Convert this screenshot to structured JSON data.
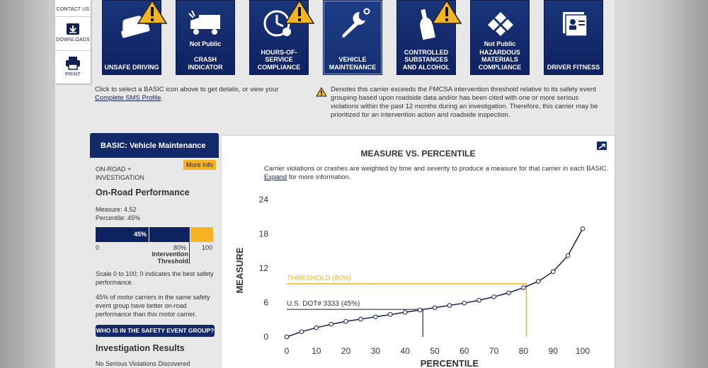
{
  "toolbar": {
    "contact": "CONTACT US",
    "downloads": "DOWNLOADS",
    "print": "PRINT"
  },
  "basics": [
    {
      "label": "UNSAFE DRIVING",
      "not_public": "",
      "warning": true
    },
    {
      "label": "CRASH INDICATOR",
      "not_public": "Not Public",
      "warning": false
    },
    {
      "label": "HOURS-OF-SERVICE COMPLIANCE",
      "not_public": "",
      "warning": true
    },
    {
      "label": "VEHICLE MAINTENANCE",
      "not_public": "",
      "warning": false,
      "selected": true
    },
    {
      "label": "CONTROLLED SUBSTANCES AND ALCOHOL",
      "not_public": "",
      "warning": true
    },
    {
      "label": "HAZARDOUS MATERIALS COMPLIANCE",
      "not_public": "Not Public",
      "warning": false
    },
    {
      "label": "DRIVER FITNESS",
      "not_public": "",
      "warning": false
    }
  ],
  "intro": {
    "text": "Click to select a BASIC icon above to get details, or view your",
    "link": "Complete SMS Profile",
    "after": "."
  },
  "warning_note": "Denotes this carrier exceeds the FMCSA intervention threshold relative to its safety event grouping based upon roadside data and/or has been cited with one or more serious violations within the past 12 months during an investigation. Therefore, this carrier may be prioritized for an intervention action and roadside inspection.",
  "panel": {
    "header": "BASIC: Vehicle Maintenance",
    "sub1": "ON-ROAD +",
    "sub2": "INVESTIGATION",
    "more_info": "More Info",
    "onroad_title": "On-Road Performance",
    "measure": "Measure: 4.52",
    "percentile": "Percentile: 45%",
    "bar_value": "45%",
    "bar_fraction": 0.45,
    "bar_min": "0",
    "bar_threshold": "80%",
    "threshold_label1": "Intervention",
    "threshold_label2": "Threshold",
    "bar_max": "100",
    "scale_text": "Scale 0 to 100; 0 indicates the best safety performance.",
    "group_text": "45% of motor carriers in the same safety event group have better on-road performance than this motor carrier.",
    "group_button": "WHO IS IN THE SAFETY EVENT GROUP?",
    "investigation_title": "Investigation Results",
    "investigation_text": "No Serious Violations Discovered"
  },
  "chart": {
    "title": "MEASURE VS. PERCENTILE",
    "desc": "Carrier violations or crashes are weighted by time and severity to produce a measure for that carrier in each BASIC.",
    "expand_link": "Expand",
    "expand_after": " for more information."
  },
  "chart_data": {
    "type": "line",
    "xlabel": "PERCENTILE",
    "ylabel": "MEASURE",
    "xlim": [
      0,
      100
    ],
    "ylim": [
      0,
      24
    ],
    "xticks": [
      0,
      10,
      20,
      30,
      40,
      50,
      60,
      70,
      80,
      90,
      100
    ],
    "yticks": [
      0,
      6,
      12,
      18,
      24
    ],
    "x": [
      0,
      5,
      10,
      15,
      20,
      25,
      30,
      35,
      40,
      45,
      50,
      55,
      60,
      65,
      70,
      75,
      80,
      85,
      90,
      95,
      100
    ],
    "y": [
      0,
      0.9,
      1.6,
      2.2,
      2.7,
      3.1,
      3.5,
      3.9,
      4.3,
      4.7,
      5.1,
      5.5,
      5.9,
      6.4,
      7.0,
      7.7,
      8.6,
      9.7,
      11.4,
      14.2,
      18.9
    ],
    "threshold": {
      "label": "THRESHOLD (80%)",
      "x": 81,
      "y": 9.3,
      "color": "#f5b321"
    },
    "carrier": {
      "label": "U.S. DOT# 3333 (45%)",
      "x": 46,
      "y": 4.8,
      "color": "#333333"
    },
    "grid": false,
    "line_color": "#13224f"
  },
  "colors": {
    "navy": "#13296a",
    "gold": "#f5b321"
  }
}
